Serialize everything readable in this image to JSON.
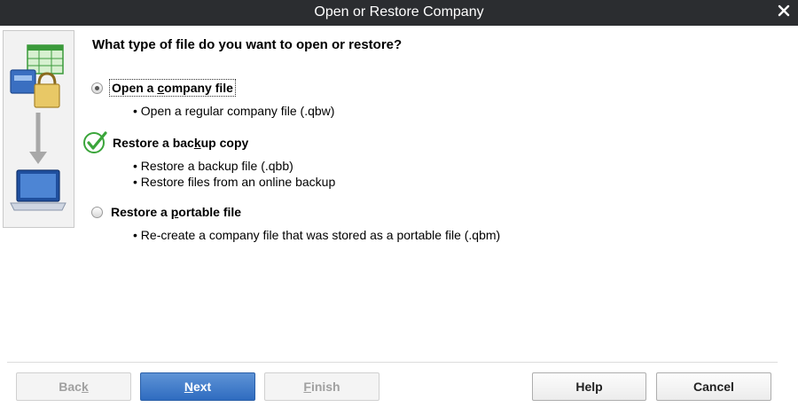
{
  "window": {
    "title": "Open or Restore Company"
  },
  "heading": "What type of file do you want to open or restore?",
  "options": [
    {
      "pre": "Open a ",
      "hot": "c",
      "post": "ompany file",
      "selected": true,
      "bullets": [
        "• Open a regular company file (.qbw)"
      ]
    },
    {
      "pre": "Restore a bac",
      "hot": "k",
      "post": "up copy",
      "selected": false,
      "bullets": [
        "• Restore a backup file (.qbb)",
        "• Restore files from an online backup"
      ]
    },
    {
      "pre": "Restore a ",
      "hot": "p",
      "post": "ortable file",
      "selected": false,
      "bullets": [
        "• Re-create a company file that was stored as a portable file (.qbm)"
      ]
    }
  ],
  "buttons": {
    "back": {
      "pre": "Bac",
      "hot": "k",
      "post": "",
      "enabled": false
    },
    "next": {
      "pre": "",
      "hot": "N",
      "post": "ext",
      "enabled": true
    },
    "finish": {
      "pre": "",
      "hot": "F",
      "post": "inish",
      "enabled": false
    },
    "help": {
      "label": "Help"
    },
    "cancel": {
      "label": "Cancel"
    }
  },
  "icons": {
    "close": "close-icon",
    "check": "checkmark-icon",
    "illustration": "file-to-laptop-illustration"
  },
  "colors": {
    "titlebar": "#2b2d30",
    "primary_button": "#3a77c8",
    "check_green": "#3aa53a"
  }
}
